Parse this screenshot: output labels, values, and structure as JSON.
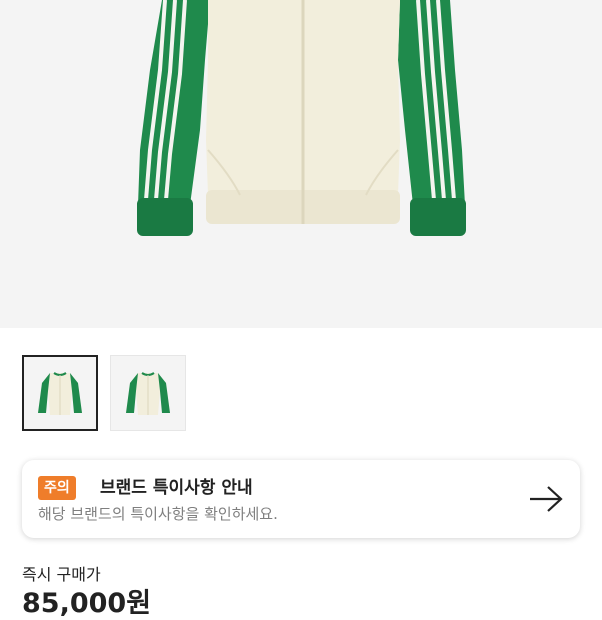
{
  "product": {
    "main_image": "green-cream-track-jacket-photo",
    "thumbnails": [
      {
        "name": "thumbnail-1",
        "image": "track-jacket-front",
        "selected": true
      },
      {
        "name": "thumbnail-2",
        "image": "track-jacket-front-alt",
        "selected": false
      }
    ]
  },
  "notice": {
    "badge": "주의",
    "title": "브랜드 특이사항 안내",
    "description": "해당 브랜드의 특이사항을 확인하세요.",
    "icon": "arrow-right-icon",
    "badge_color": "#ef7d2a"
  },
  "purchase": {
    "label": "즉시 구매가",
    "price": "85,000원"
  },
  "colors": {
    "jacket_green": "#1f8a4c",
    "jacket_cream": "#f2eedc"
  }
}
